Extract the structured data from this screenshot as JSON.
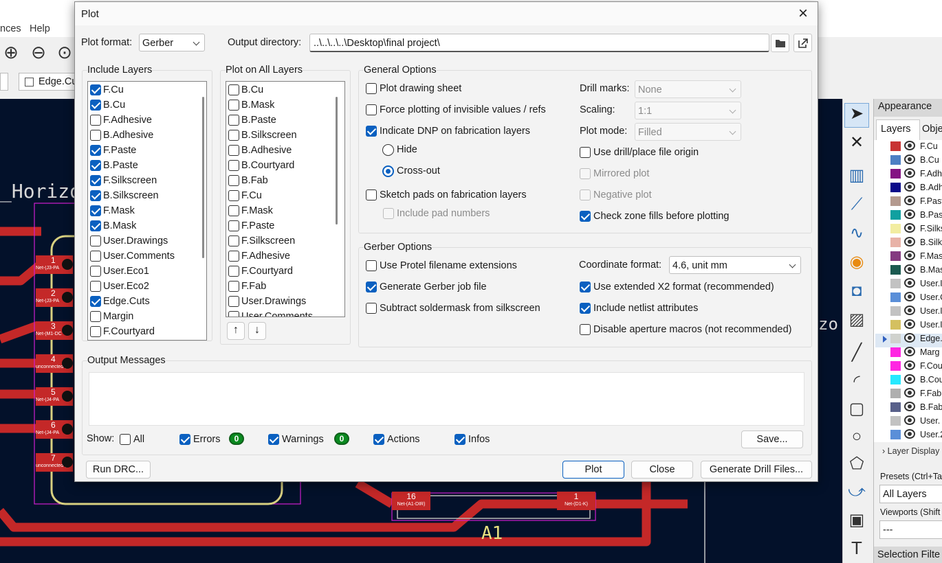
{
  "background_app": {
    "menu": [
      "nces",
      "Help"
    ],
    "layer_combo": "Edge.Cu",
    "canvas_labels": {
      "footprint_name_left": "_Horizon",
      "footprint_name_right": "zo",
      "a1_ref": "A1",
      "pins": [
        {
          "num": "1",
          "net": "Net-(J3-PA"
        },
        {
          "num": "2",
          "net": "Net-(J3-PA"
        },
        {
          "num": "3",
          "net": "Net-(M1-DC"
        },
        {
          "num": "4",
          "net": "unconnected-(J4"
        },
        {
          "num": "5",
          "net": "Net-(J4-PA"
        },
        {
          "num": "6",
          "net": "Net-(J4-PA"
        },
        {
          "num": "7",
          "net": "unconnected-(J4"
        }
      ],
      "pad16": {
        "num": "16",
        "net": "Net-(A1-DIR)"
      },
      "pad1": {
        "num": "1",
        "net": "Net-(D1-K)"
      }
    },
    "appearance": {
      "title": "Appearance",
      "tab_layers": "Layers",
      "tab_objects": "Obje",
      "layers": [
        {
          "name": "F.Cu",
          "color": "#c83434"
        },
        {
          "name": "B.Cu",
          "color": "#4d7fc4"
        },
        {
          "name": "F.Adh",
          "color": "#841383"
        },
        {
          "name": "B.Adh",
          "color": "#0a0a8a"
        },
        {
          "name": "F.Past",
          "color": "#b49a8f"
        },
        {
          "name": "B.Past",
          "color": "#10a0a0"
        },
        {
          "name": "F.Silks",
          "color": "#f2eda1"
        },
        {
          "name": "B.Silks",
          "color": "#e8b2a7"
        },
        {
          "name": "F.Mas",
          "color": "#843a80"
        },
        {
          "name": "B.Mas",
          "color": "#1b5a50"
        },
        {
          "name": "User.I",
          "color": "#c2c2c2"
        },
        {
          "name": "User.C",
          "color": "#5a8fd8"
        },
        {
          "name": "User.I",
          "color": "#c2c2c2"
        },
        {
          "name": "User.I",
          "color": "#d4c060"
        },
        {
          "name": "Edge.",
          "color": "#d0d2cd"
        },
        {
          "name": "Marg",
          "color": "#ff26e2"
        },
        {
          "name": "F.Cou",
          "color": "#ff26e2"
        },
        {
          "name": "B.Cou",
          "color": "#26e9ff"
        },
        {
          "name": "F.Fab",
          "color": "#afafaf"
        },
        {
          "name": "B.Fab",
          "color": "#58608a"
        },
        {
          "name": "User.",
          "color": "#c2c2c2"
        },
        {
          "name": "User.2",
          "color": "#5a8fd8"
        }
      ],
      "layer_display": "Layer Display",
      "presets_label": "Presets (Ctrl+Ta",
      "presets_value": "All Layers",
      "viewports_label": "Viewports (Shift",
      "viewports_value": "---",
      "selection_filter": "Selection Filte"
    }
  },
  "dialog": {
    "title": "Plot",
    "plot_format_label": "Plot format:",
    "plot_format_value": "Gerber",
    "output_dir_label": "Output directory:",
    "output_dir_value": "..\\..\\..\\..\\Desktop\\final project\\",
    "include_layers": {
      "title": "Include Layers",
      "items": [
        {
          "label": "F.Cu",
          "checked": true
        },
        {
          "label": "B.Cu",
          "checked": true
        },
        {
          "label": "F.Adhesive",
          "checked": false
        },
        {
          "label": "B.Adhesive",
          "checked": false
        },
        {
          "label": "F.Paste",
          "checked": true
        },
        {
          "label": "B.Paste",
          "checked": true
        },
        {
          "label": "F.Silkscreen",
          "checked": true
        },
        {
          "label": "B.Silkscreen",
          "checked": true
        },
        {
          "label": "F.Mask",
          "checked": true
        },
        {
          "label": "B.Mask",
          "checked": true
        },
        {
          "label": "User.Drawings",
          "checked": false
        },
        {
          "label": "User.Comments",
          "checked": false
        },
        {
          "label": "User.Eco1",
          "checked": false
        },
        {
          "label": "User.Eco2",
          "checked": false
        },
        {
          "label": "Edge.Cuts",
          "checked": true
        },
        {
          "label": "Margin",
          "checked": false
        },
        {
          "label": "F.Courtyard",
          "checked": false
        }
      ]
    },
    "plot_all_layers": {
      "title": "Plot on All Layers",
      "items": [
        {
          "label": "B.Cu",
          "checked": false
        },
        {
          "label": "B.Mask",
          "checked": false
        },
        {
          "label": "B.Paste",
          "checked": false
        },
        {
          "label": "B.Silkscreen",
          "checked": false
        },
        {
          "label": "B.Adhesive",
          "checked": false
        },
        {
          "label": "B.Courtyard",
          "checked": false
        },
        {
          "label": "B.Fab",
          "checked": false
        },
        {
          "label": "F.Cu",
          "checked": false
        },
        {
          "label": "F.Mask",
          "checked": false
        },
        {
          "label": "F.Paste",
          "checked": false
        },
        {
          "label": "F.Silkscreen",
          "checked": false
        },
        {
          "label": "F.Adhesive",
          "checked": false
        },
        {
          "label": "F.Courtyard",
          "checked": false
        },
        {
          "label": "F.Fab",
          "checked": false
        },
        {
          "label": "User.Drawings",
          "checked": false
        },
        {
          "label": "User.Comments",
          "checked": false
        }
      ]
    },
    "general_options": {
      "title": "General Options",
      "plot_drawing_sheet": {
        "label": "Plot drawing sheet",
        "checked": false
      },
      "force_invisible": {
        "label": "Force plotting of invisible values / refs",
        "checked": false
      },
      "indicate_dnp": {
        "label": "Indicate DNP on fabrication layers",
        "checked": true
      },
      "hide": {
        "label": "Hide",
        "selected": false
      },
      "cross_out": {
        "label": "Cross-out",
        "selected": true
      },
      "sketch_pads": {
        "label": "Sketch pads on fabrication layers",
        "checked": false
      },
      "include_pad_numbers": {
        "label": "Include pad numbers",
        "checked": false
      },
      "drill_marks_label": "Drill marks:",
      "drill_marks_value": "None",
      "scaling_label": "Scaling:",
      "scaling_value": "1:1",
      "plot_mode_label": "Plot mode:",
      "plot_mode_value": "Filled",
      "use_drill_origin": {
        "label": "Use drill/place file origin",
        "checked": false
      },
      "mirrored_plot": {
        "label": "Mirrored plot",
        "checked": false
      },
      "negative_plot": {
        "label": "Negative plot",
        "checked": false
      },
      "check_zone_fills": {
        "label": "Check zone fills before plotting",
        "checked": true
      }
    },
    "gerber_options": {
      "title": "Gerber Options",
      "protel": {
        "label": "Use Protel filename extensions",
        "checked": false
      },
      "job_file": {
        "label": "Generate Gerber job file",
        "checked": true
      },
      "subtract_mask": {
        "label": "Subtract soldermask from silkscreen",
        "checked": false
      },
      "coord_format_label": "Coordinate format:",
      "coord_format_value": "4.6, unit mm",
      "x2_format": {
        "label": "Use extended X2 format (recommended)",
        "checked": true
      },
      "netlist_attrs": {
        "label": "Include netlist attributes",
        "checked": true
      },
      "disable_aperture": {
        "label": "Disable aperture macros (not recommended)",
        "checked": false
      }
    },
    "output_messages": {
      "title": "Output Messages",
      "show_label": "Show:",
      "all": {
        "label": "All",
        "checked": false
      },
      "errors": {
        "label": "Errors",
        "checked": true,
        "count": "0"
      },
      "warnings": {
        "label": "Warnings",
        "checked": true,
        "count": "0"
      },
      "actions": {
        "label": "Actions",
        "checked": true
      },
      "infos": {
        "label": "Infos",
        "checked": true
      },
      "save_label": "Save..."
    },
    "buttons": {
      "run_drc": "Run DRC...",
      "plot": "Plot",
      "close": "Close",
      "drill_files": "Generate Drill Files..."
    }
  }
}
